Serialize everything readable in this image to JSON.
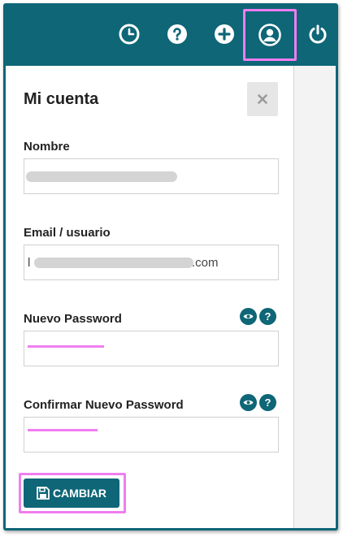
{
  "topbar": {
    "icons": [
      "history-icon",
      "help-icon",
      "add-icon",
      "user-icon",
      "power-icon"
    ]
  },
  "panel": {
    "title": "Mi cuenta",
    "close_icon": "close-icon"
  },
  "form": {
    "name_label": "Nombre",
    "email_label": "Email / usuario",
    "email_value_suffix": ".com",
    "email_value_prefix": "l",
    "new_password_label": "Nuevo Password",
    "confirm_password_label": "Confirmar Nuevo Password",
    "help_glyph": "?"
  },
  "actions": {
    "save_label": "CAMBIAR",
    "save_icon": "floppy-disk-icon"
  },
  "colors": {
    "primary": "#0e6677",
    "highlight": "#f07df0"
  }
}
